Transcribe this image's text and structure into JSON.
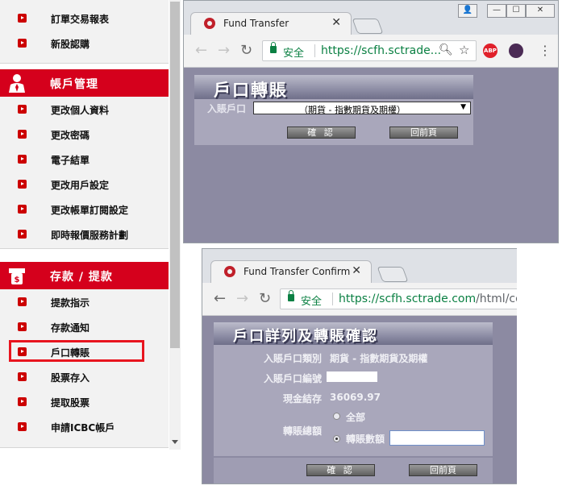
{
  "sidebar": {
    "top_items": [
      "訂單交易報表",
      "新股認購"
    ],
    "account_header": "帳戶管理",
    "account_items": [
      "更改個人資料",
      "更改密碼",
      "電子結單",
      "更改用戶設定",
      "更改帳單訂閱設定",
      "即時報價服務計劃"
    ],
    "deposit_header": "存款 / 提款",
    "deposit_items": [
      "提款指示",
      "存款通知",
      "戶口轉賬",
      "股票存入",
      "提取股票",
      "申請ICBC帳戶"
    ],
    "highlighted_item": "戶口轉賬",
    "accent_color": "#d5001c"
  },
  "window1": {
    "tab_title": "Fund Transfer",
    "secure_label": "安全",
    "url_host": "https://scfh.sctrade...",
    "banner_title": "戶口轉賬",
    "to_account_label": "入賬戶口",
    "to_account_value": "（期貨 - 指數期貨及期權）",
    "confirm_button": "確 認",
    "back_button": "回前頁"
  },
  "window2": {
    "tab_title": "Fund Transfer Confirma",
    "secure_label": "安全",
    "url_host": "https://scfh.sctrade.com",
    "url_path": "/html/cor",
    "banner_title": "戶口詳列及轉賬確認",
    "account_type_label": "入賬戶口類別",
    "account_type_value": "期貨 - 指數期貨及期權",
    "account_number_label": "入賬戶口編號",
    "cash_balance_label": "現金結存",
    "cash_balance_value": "36069.97",
    "transfer_amount_label": "轉賬總額",
    "option_all": "全部",
    "option_amount": "轉賬數額",
    "confirm_button": "確 認",
    "back_button": "回前頁"
  }
}
